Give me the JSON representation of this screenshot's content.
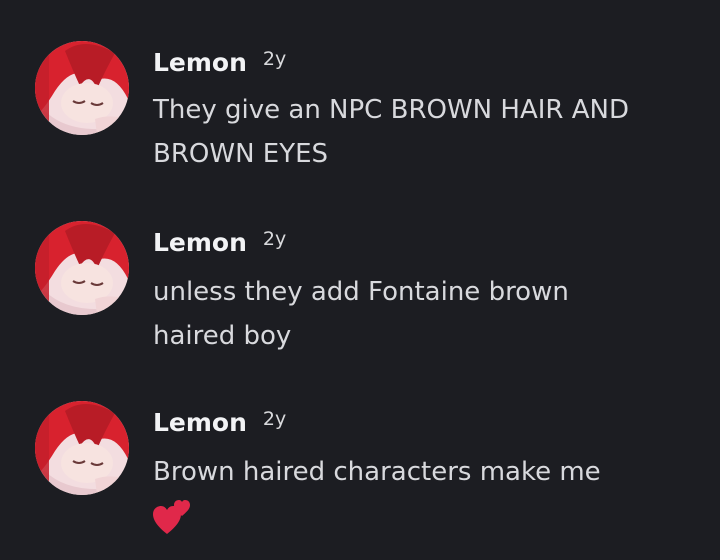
{
  "messages": [
    {
      "username": "Lemon",
      "timestamp": "2y",
      "avatar_icon": "anime-avatar-red-hair",
      "lines": [
        "They give an NPC BROWN HAIR AND",
        "BROWN EYES"
      ]
    },
    {
      "username": "Lemon",
      "timestamp": "2y",
      "avatar_icon": "anime-avatar-red-hair",
      "lines": [
        "unless they add Fontaine brown",
        "haired boy"
      ]
    },
    {
      "username": "Lemon",
      "timestamp": "2y",
      "avatar_icon": "anime-avatar-red-hair",
      "lines": [
        "Brown haired characters make me"
      ],
      "emoji": "two-hearts-emoji"
    }
  ],
  "colors": {
    "background": "#1c1d22",
    "username": "#f2f3f5",
    "text": "#d8d9dd",
    "heart": "#e0284a"
  }
}
